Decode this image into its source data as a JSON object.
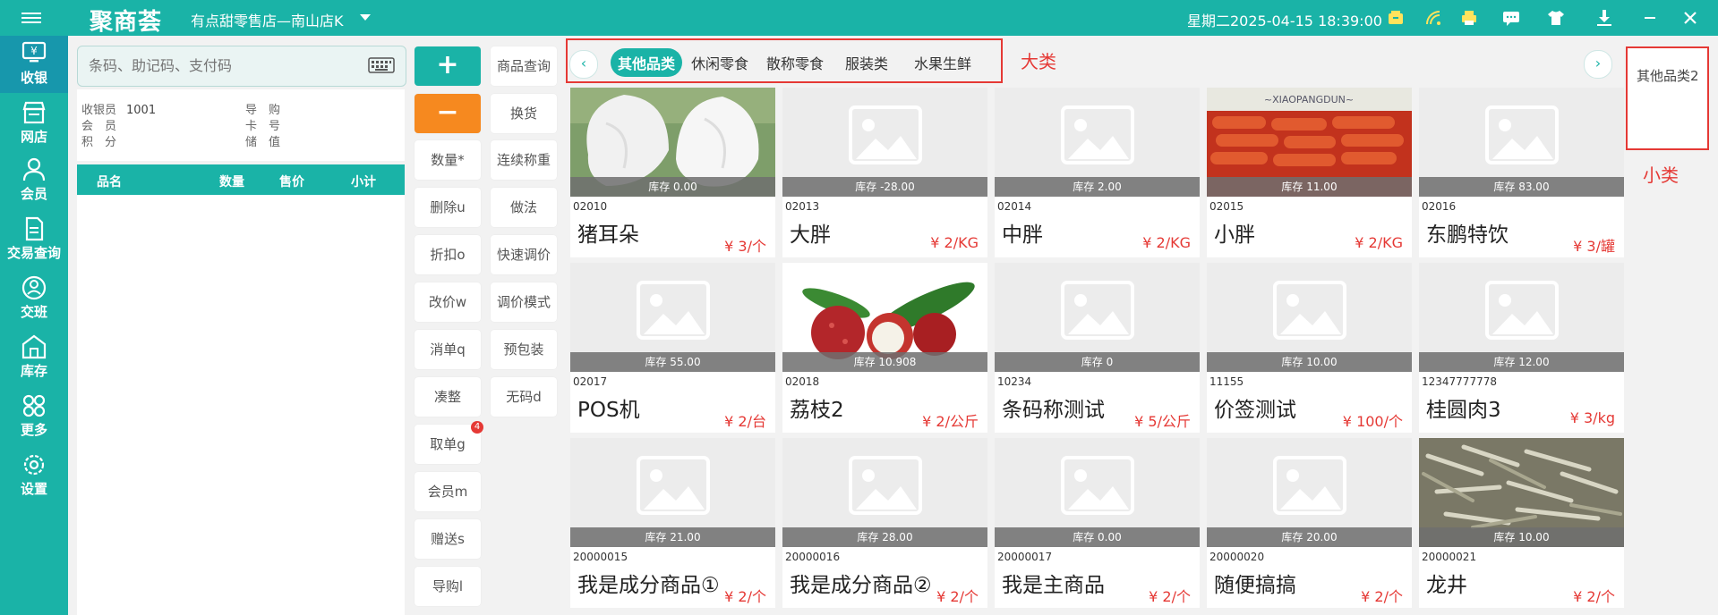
{
  "app": {
    "logo": "聚商荟",
    "store_name": "有点甜零售店—南山店K",
    "datetime": "星期二2025-04-15 18:39:00"
  },
  "sidebar": {
    "items": [
      {
        "label": "收银",
        "icon": "yen-monitor-icon",
        "active": true
      },
      {
        "label": "网店",
        "icon": "storefront-icon",
        "active": false
      },
      {
        "label": "会员",
        "icon": "person-icon",
        "active": false
      },
      {
        "label": "交易查询",
        "icon": "document-icon",
        "active": false
      },
      {
        "label": "交班",
        "icon": "shift-handover-icon",
        "active": false
      },
      {
        "label": "库存",
        "icon": "warehouse-icon",
        "active": false
      },
      {
        "label": "更多",
        "icon": "more-grid-icon",
        "active": false
      },
      {
        "label": "设置",
        "icon": "gear-icon",
        "active": false
      }
    ]
  },
  "search": {
    "placeholder": "条码、助记码、支付码"
  },
  "info": {
    "cashier_label": "收银员",
    "cashier_value": "1001",
    "member_label": "会　员",
    "points_label": "积　分",
    "guide_label": "导　购",
    "card_label": "卡　号",
    "stored_label": "储　值"
  },
  "cart": {
    "headers": [
      "品名",
      "数量",
      "售价",
      "小计"
    ]
  },
  "actions": {
    "col1": [
      "+",
      "−",
      "数量*",
      "删除u",
      "折扣o",
      "改价w",
      "消单q",
      "凑整",
      "取单g",
      "会员m",
      "赠送s",
      "导购l"
    ],
    "col2": [
      "商品查询",
      "换货",
      "连续称重",
      "做法",
      "快速调价",
      "调价模式",
      "预包装",
      "无码d"
    ],
    "pending_badge": "4"
  },
  "categories": {
    "items": [
      "其他品类",
      "休闲零食",
      "散称零食",
      "服装类",
      "水果生鲜"
    ],
    "active_index": 0,
    "note": "大类"
  },
  "subcategories": {
    "items": [
      "其他品类2"
    ],
    "note": "小类"
  },
  "products": [
    {
      "code": "02010",
      "name": "猪耳朵",
      "price": "¥ 3/个",
      "stock": "库存 0.00",
      "image": "pig-ear-photo"
    },
    {
      "code": "02013",
      "name": "大胖",
      "price": "¥ 2/KG",
      "stock": "库存 -28.00",
      "image": "placeholder"
    },
    {
      "code": "02014",
      "name": "中胖",
      "price": "¥ 2/KG",
      "stock": "库存 2.00",
      "image": "placeholder"
    },
    {
      "code": "02015",
      "name": "小胖",
      "price": "¥ 2/KG",
      "stock": "库存 11.00",
      "image": "sausage-photo"
    },
    {
      "code": "02016",
      "name": "东鹏特饮",
      "price": "¥ 3/罐",
      "stock": "库存 83.00",
      "image": "placeholder"
    },
    {
      "code": "02017",
      "name": "POS机",
      "price": "¥ 2/台",
      "stock": "库存 55.00",
      "image": "placeholder"
    },
    {
      "code": "02018",
      "name": "荔枝2",
      "price": "¥ 2/公斤",
      "stock": "库存 10.908",
      "image": "lychee-photo"
    },
    {
      "code": "10234",
      "name": "条码称测试",
      "price": "¥ 5/公斤",
      "stock": "库存 0",
      "image": "placeholder"
    },
    {
      "code": "11155",
      "name": "价签测试",
      "price": "¥ 100/个",
      "stock": "库存 10.00",
      "image": "placeholder"
    },
    {
      "code": "12347777778",
      "name": "桂圆肉3",
      "price": "¥ 3/kg",
      "stock": "库存 12.00",
      "image": "placeholder"
    },
    {
      "code": "20000015",
      "name": "我是成分商品①",
      "price": "¥ 2/个",
      "stock": "库存 21.00",
      "image": "placeholder"
    },
    {
      "code": "20000016",
      "name": "我是成分商品②",
      "price": "¥ 2/个",
      "stock": "库存 28.00",
      "image": "placeholder"
    },
    {
      "code": "20000017",
      "name": "我是主商品",
      "price": "¥ 2/个",
      "stock": "库存 0.00",
      "image": "placeholder"
    },
    {
      "code": "20000020",
      "name": "随便搞搞",
      "price": "¥ 2/个",
      "stock": "库存 20.00",
      "image": "placeholder"
    },
    {
      "code": "20000021",
      "name": "龙井",
      "price": "¥ 2/个",
      "stock": "库存 10.00",
      "image": "tea-leaves-photo"
    }
  ],
  "colors": {
    "teal": "#1ab3a7",
    "orange": "#f6891f",
    "red": "#e53935"
  }
}
